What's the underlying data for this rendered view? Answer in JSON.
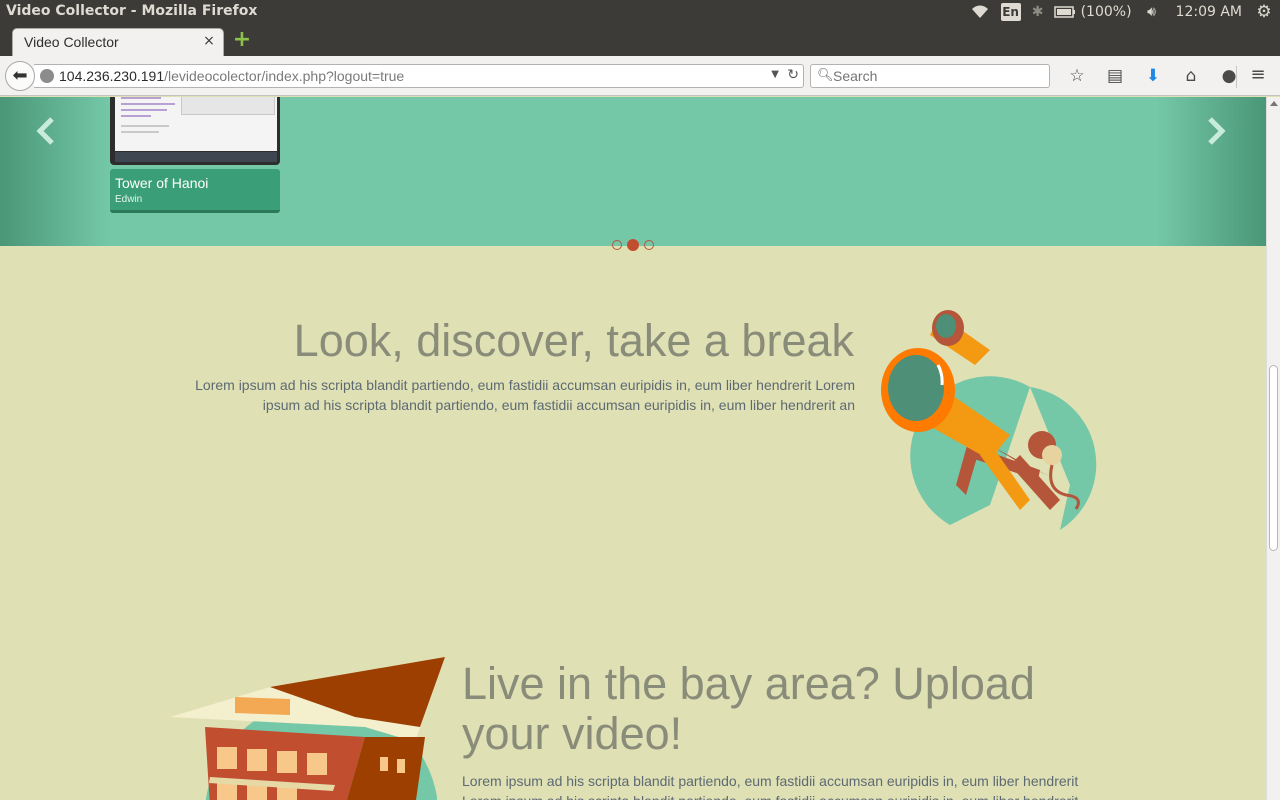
{
  "os": {
    "window_title": "Video Collector - Mozilla Firefox",
    "keyboard_layout": "En",
    "battery": "(100%)",
    "clock": "12:09 AM"
  },
  "browser": {
    "tab_title": "Video Collector",
    "tab_close": "×",
    "new_tab": "+",
    "url_host": "104.236.230.191",
    "url_path": "/levideocolector/index.php?logout=true",
    "search_placeholder": "Search"
  },
  "carousel": {
    "prev": "‹",
    "next": "›",
    "video": {
      "title": "Tower of Hanoi",
      "author": "Edwin"
    },
    "dots_total": 3,
    "dots_active_index": 1
  },
  "features": [
    {
      "title": "Look, discover, take a break",
      "text": "Lorem ipsum ad his scripta blandit partiendo, eum fastidii accumsan euripidis in, eum liber hendrerit Lorem ipsum ad his scripta blandit partiendo, eum fastidii accumsan euripidis in, eum liber hendrerit an"
    },
    {
      "title": "Live in the bay area? Upload your video!",
      "text": "Lorem ipsum ad his scripta blandit partiendo, eum fastidii accumsan euripidis in, eum liber hendrerit Lorem ipsum ad his scripta blandit partiendo, eum fastidii accumsan euripidis in, eum liber hendrerit"
    }
  ],
  "colors": {
    "carousel_bg": "#74c8a8",
    "page_bg": "#dfe0b4",
    "accent": "#c24e30",
    "caption_bg": "#3a9e78"
  }
}
